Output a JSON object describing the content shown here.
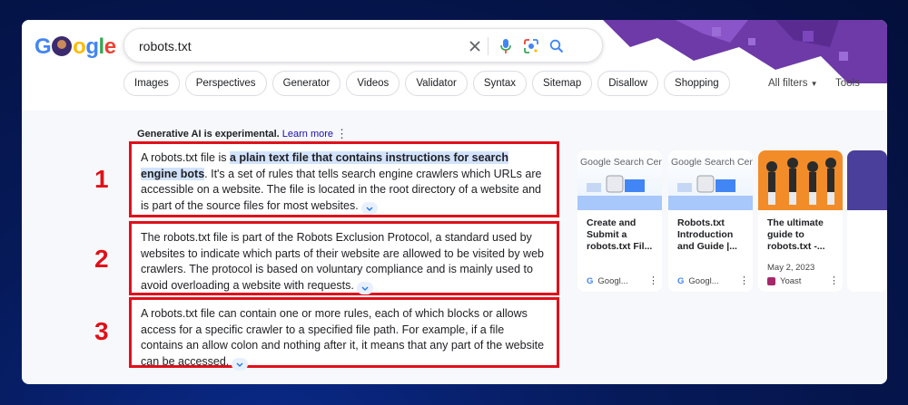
{
  "colors": {
    "accent_red": "#e0101a",
    "link": "#1a0dab",
    "highlight": "#d3e3fd",
    "doodle_purple": "#6d3aa8"
  },
  "logo": {
    "letters": [
      "G",
      "",
      "o",
      "g",
      "l",
      "e"
    ]
  },
  "search": {
    "query": "robots.txt",
    "icons": [
      "clear-icon",
      "microphone-icon",
      "lens-icon",
      "search-icon"
    ]
  },
  "chips": [
    "Images",
    "Perspectives",
    "Generator",
    "Videos",
    "Validator",
    "Syntax",
    "Sitemap",
    "Disallow",
    "Shopping"
  ],
  "filters": {
    "all_filters": "All filters",
    "tools": "Tools"
  },
  "ai": {
    "experimental": "Generative AI is experimental.",
    "learn_more": "Learn more"
  },
  "paragraphs": [
    {
      "number": "1",
      "pre": "A robots.txt file is ",
      "highlight": "a plain text file that contains instructions for search engine bots",
      "post": ". It's a set of rules that tells search engine crawlers which URLs are accessible on a website. The file is located in the root directory of a website and is part of the source files for most websites."
    },
    {
      "number": "2",
      "pre": "The robots.txt file is part of the Robots Exclusion Protocol, a standard used by websites to indicate which parts of their website are allowed to be visited by web crawlers. The protocol is based on voluntary compliance and is mainly used to avoid overloading a website with requests.",
      "highlight": "",
      "post": ""
    },
    {
      "number": "3",
      "pre": "A robots.txt file can contain one or more rules, each of which blocks or allows access for a specific crawler to a specified file path. For example, if a file contains an allow colon and nothing after it, it means that any part of the website can be accessed.",
      "highlight": "",
      "post": ""
    }
  ],
  "sources": [
    {
      "thumb_title": "Google Search Centr",
      "title": "Create and Submit a robots.txt Fil...",
      "date": "",
      "site": "Googl..."
    },
    {
      "thumb_title": "Google Search Centr",
      "title": "Robots.txt Introduction and Guide |...",
      "date": "",
      "site": "Googl..."
    },
    {
      "thumb_title": "",
      "title": "The ultimate guide to robots.txt -...",
      "date": "May 2, 2023",
      "site": "Yoast"
    }
  ]
}
